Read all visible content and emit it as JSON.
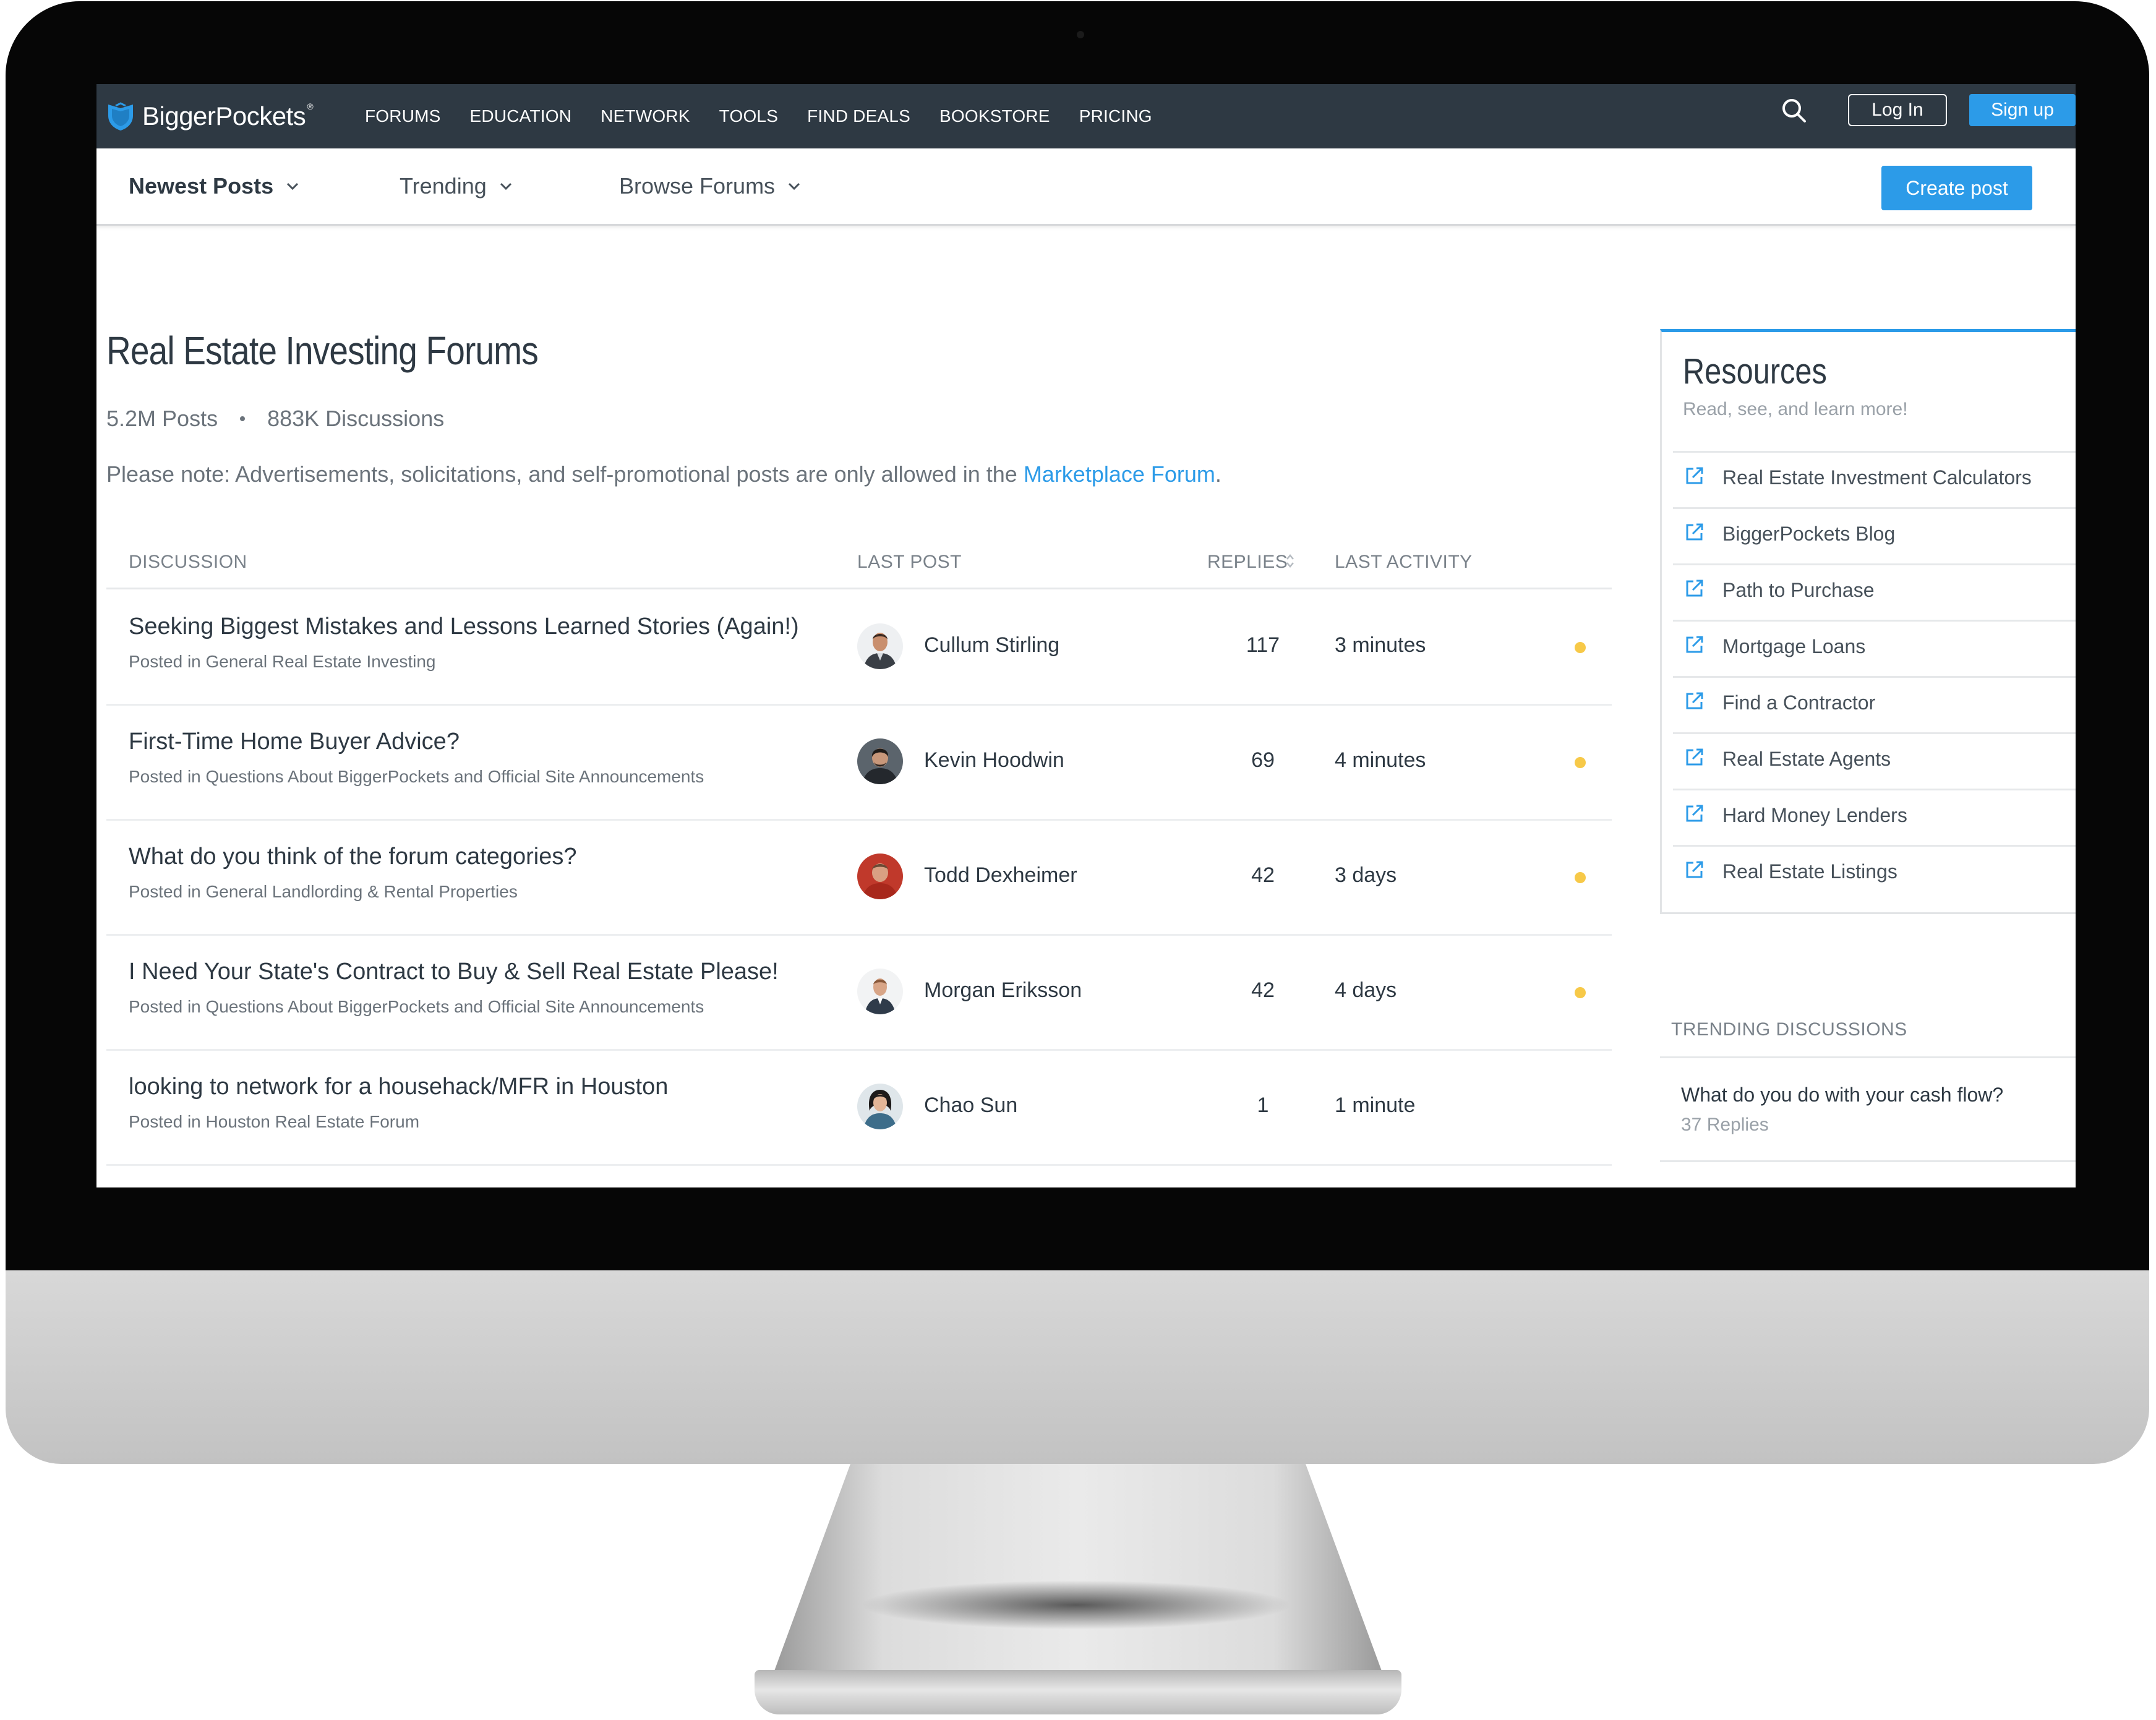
{
  "topnav": {
    "logo_text": "BiggerPockets",
    "logo_reg": "®",
    "links": [
      "FORUMS",
      "EDUCATION",
      "NETWORK",
      "TOOLS",
      "FIND DEALS",
      "BOOKSTORE",
      "PRICING"
    ],
    "login_label": "Log In",
    "signup_label": "Sign up",
    "icons": {
      "search": "search-icon",
      "logo": "shield-logo-icon"
    }
  },
  "subnav": {
    "items": [
      "Newest Posts",
      "Trending",
      "Browse Forums"
    ],
    "active": "Newest Posts",
    "create_label": "Create post"
  },
  "page": {
    "title": "Real Estate Investing Forums",
    "posts_count": "5.2M Posts",
    "discussions_count": "883K Discussions",
    "notice_prefix": "Please note: Advertisements, solicitations, and self-promotional posts are only allowed in the ",
    "notice_link": "Marketplace Forum",
    "notice_suffix": "."
  },
  "table": {
    "columns": [
      "DISCUSSION",
      "LAST POST",
      "REPLIES",
      "LAST ACTIVITY"
    ],
    "rows": [
      {
        "title": "Seeking Biggest Mistakes and Lessons Learned Stories (Again!)",
        "posted_in": "Posted in General Real Estate Investing",
        "author": "Cullum Stirling",
        "replies": "117",
        "activity": "3 minutes",
        "unread": true
      },
      {
        "title": "First-Time Home Buyer Advice?",
        "posted_in": "Posted in Questions About BiggerPockets and Official Site Announcements",
        "author": "Kevin Hoodwin",
        "replies": "69",
        "activity": "4 minutes",
        "unread": true
      },
      {
        "title": "What do you think of the forum categories?",
        "posted_in": "Posted in General Landlording & Rental Properties",
        "author": "Todd Dexheimer",
        "replies": "42",
        "activity": "3 days",
        "unread": true
      },
      {
        "title": "I Need Your State's Contract to Buy & Sell Real Estate Please!",
        "posted_in": "Posted in Questions About BiggerPockets and Official Site Announcements",
        "author": "Morgan Eriksson",
        "replies": "42",
        "activity": "4 days",
        "unread": true
      },
      {
        "title": "looking to network for a househack/MFR in Houston",
        "posted_in": "Posted in Houston Real Estate Forum",
        "author": "Chao Sun",
        "replies": "1",
        "activity": "1 minute",
        "unread": false
      }
    ]
  },
  "resources": {
    "title": "Resources",
    "subtitle": "Read, see, and learn more!",
    "items": [
      "Real Estate Investment Calculators",
      "BiggerPockets Blog",
      "Path to Purchase",
      "Mortgage Loans",
      "Find a Contractor",
      "Real Estate Agents",
      "Hard Money Lenders",
      "Real Estate Listings"
    ]
  },
  "trending": {
    "header": "TRENDING DISCUSSIONS",
    "items": [
      {
        "title": "What do you do with your cash flow?",
        "replies": "37 Replies"
      }
    ]
  },
  "colors": {
    "nav_bg": "#2e3943",
    "accent": "#2c9be8",
    "unread": "#f7c948"
  }
}
